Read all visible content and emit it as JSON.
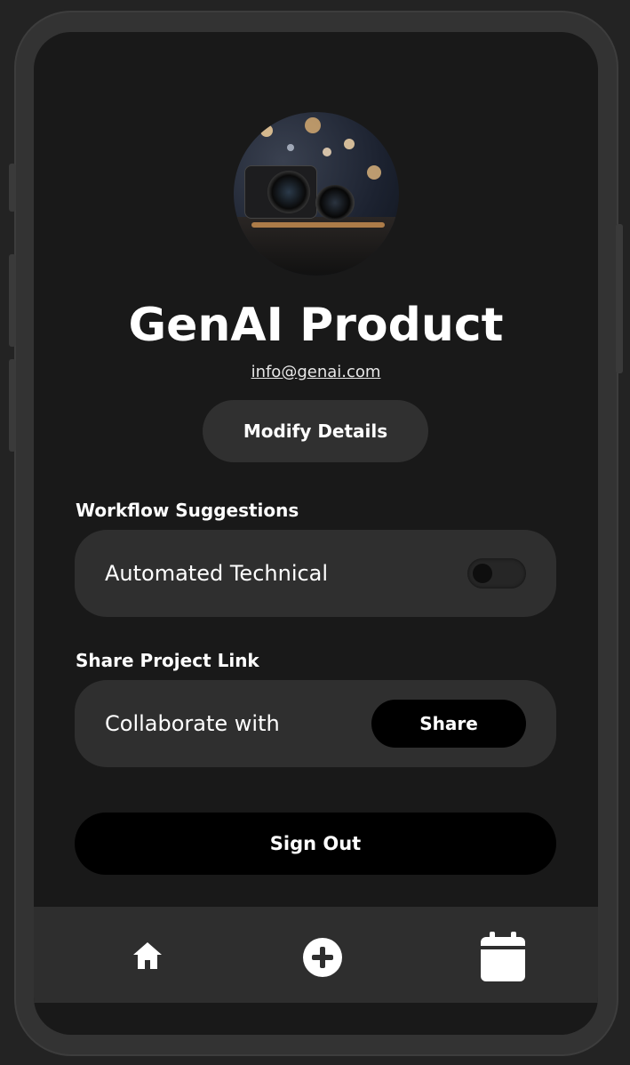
{
  "profile": {
    "name": "GenAI Product",
    "email": "info@genai.com",
    "modify_label": "Modify Details"
  },
  "workflow": {
    "section_label": "Workflow Suggestions",
    "item_label": "Automated Technical",
    "toggle_on": false
  },
  "share": {
    "section_label": "Share Project Link",
    "item_label": "Collaborate with",
    "button_label": "Share"
  },
  "signout_label": "Sign Out",
  "nav": {
    "items": [
      {
        "icon": "home-icon"
      },
      {
        "icon": "plus-circle-icon"
      },
      {
        "icon": "calendar-icon"
      }
    ]
  },
  "colors": {
    "background": "#191919",
    "card": "#2f2f2f",
    "button_dark": "#000000",
    "text": "#ffffff"
  }
}
